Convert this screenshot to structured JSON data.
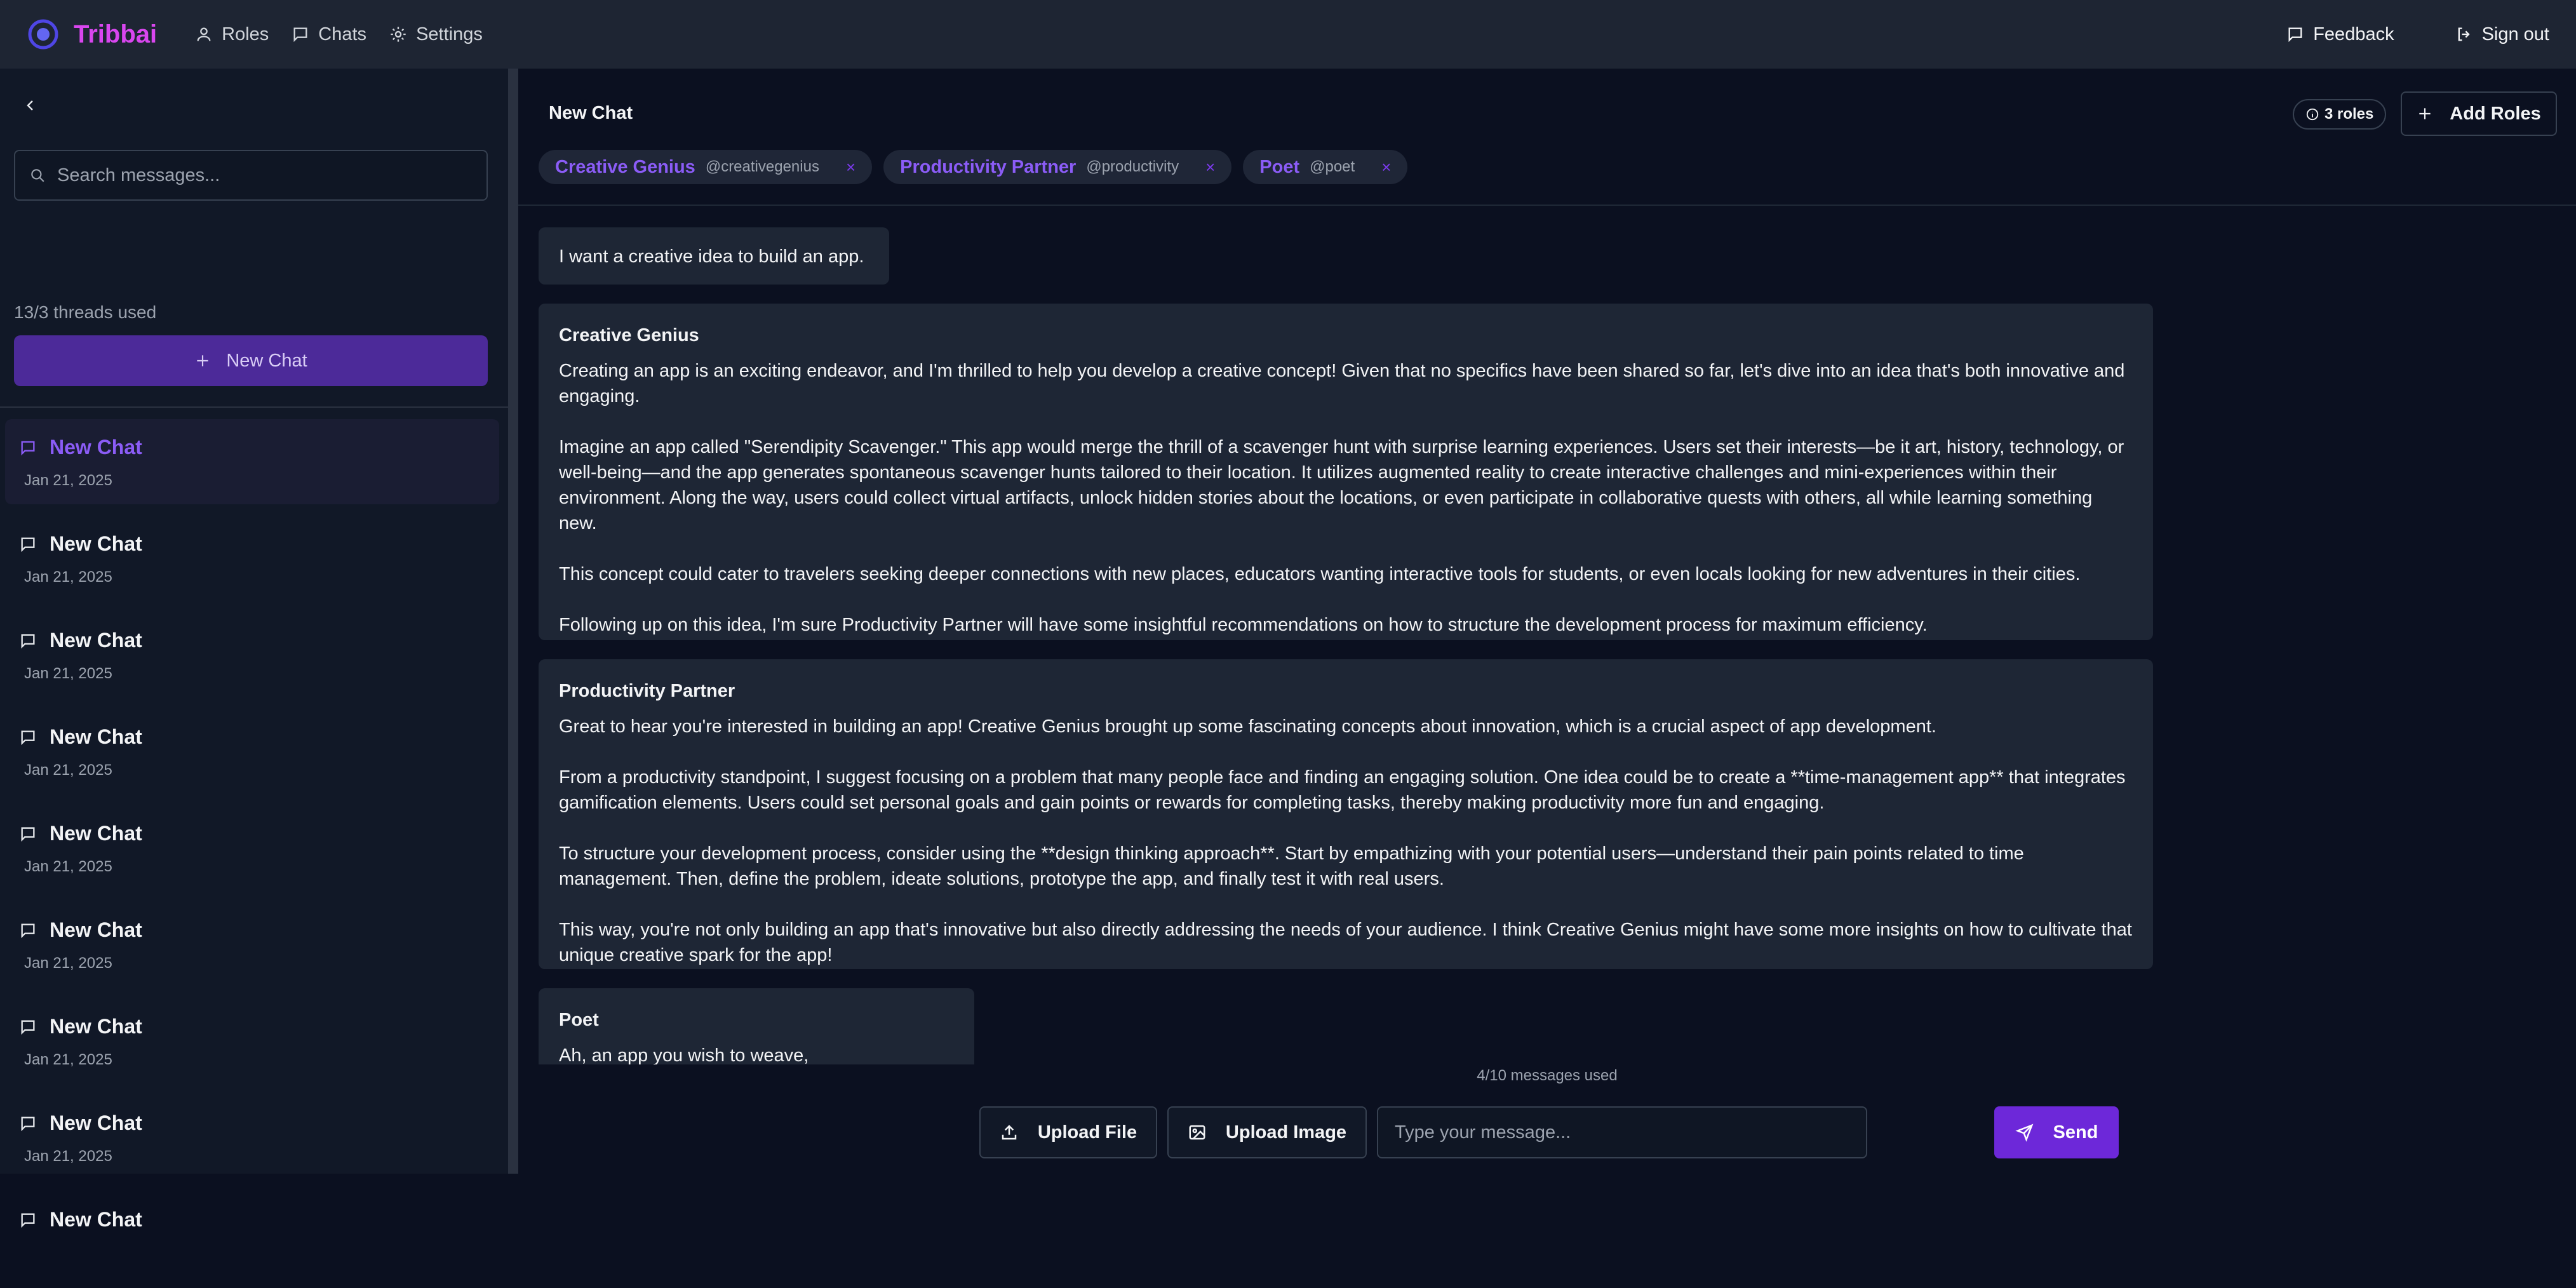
{
  "app": {
    "name": "Tribbai",
    "brand_color": "#d946ef"
  },
  "nav": {
    "items": [
      {
        "label": "Roles",
        "icon": "user-icon"
      },
      {
        "label": "Chats",
        "icon": "chat-icon"
      },
      {
        "label": "Settings",
        "icon": "gear-icon"
      }
    ],
    "feedback_label": "Feedback",
    "signout_label": "Sign out"
  },
  "sidebar": {
    "search_placeholder": "Search messages...",
    "threads_used": "13/3 threads used",
    "new_chat_label": "New Chat",
    "threads": [
      {
        "title": "New Chat",
        "date": "Jan 21, 2025",
        "active": true
      },
      {
        "title": "New Chat",
        "date": "Jan 21, 2025"
      },
      {
        "title": "New Chat",
        "date": "Jan 21, 2025"
      },
      {
        "title": "New Chat",
        "date": "Jan 21, 2025"
      },
      {
        "title": "New Chat",
        "date": "Jan 21, 2025"
      },
      {
        "title": "New Chat",
        "date": "Jan 21, 2025"
      },
      {
        "title": "New Chat",
        "date": "Jan 21, 2025"
      },
      {
        "title": "New Chat",
        "date": "Jan 21, 2025"
      },
      {
        "title": "New Chat",
        "date": ""
      }
    ]
  },
  "chat": {
    "title": "New Chat",
    "roles_count": "3 roles",
    "add_roles_label": "Add Roles",
    "roles": [
      {
        "name": "Creative Genius",
        "handle": "@creativegenius",
        "remove": "×"
      },
      {
        "name": "Productivity Partner",
        "handle": "@productivity",
        "remove": "×"
      },
      {
        "name": "Poet",
        "handle": "@poet",
        "remove": "×"
      }
    ],
    "messages": [
      {
        "sender": "",
        "paragraphs": [
          "I want a creative idea to build an app."
        ]
      },
      {
        "sender": "Creative Genius",
        "paragraphs": [
          "Creating an app is an exciting endeavor, and I'm thrilled to help you develop a creative concept! Given that no specifics have been shared so far, let's dive into an idea that's both innovative and engaging.",
          "Imagine an app called \"Serendipity Scavenger.\" This app would merge the thrill of a scavenger hunt with surprise learning experiences. Users set their interests—be it art, history, technology, or well-being—and the app generates spontaneous scavenger hunts tailored to their location. It utilizes augmented reality to create interactive challenges and mini-experiences within their environment. Along the way, users could collect virtual artifacts, unlock hidden stories about the locations, or even participate in collaborative quests with others, all while learning something new.",
          "This concept could cater to travelers seeking deeper connections with new places, educators wanting interactive tools for students, or even locals looking for new adventures in their cities.",
          "Following up on this idea, I'm sure Productivity Partner will have some insightful recommendations on how to structure the development process for maximum efficiency."
        ]
      },
      {
        "sender": "Productivity Partner",
        "paragraphs": [
          "Great to hear you're interested in building an app! Creative Genius brought up some fascinating concepts about innovation, which is a crucial aspect of app development.",
          "From a productivity standpoint, I suggest focusing on a problem that many people face and finding an engaging solution. One idea could be to create a **time-management app** that integrates gamification elements. Users could set personal goals and gain points or rewards for completing tasks, thereby making productivity more fun and engaging.",
          "To structure your development process, consider using the **design thinking approach**. Start by empathizing with your potential users—understand their pain points related to time management. Then, define the problem, ideate solutions, prototype the app, and finally test it with real users.",
          "This way, you're not only building an app that's innovative but also directly addressing the needs of your audience. I think Creative Genius might have some more insights on how to cultivate that unique creative spark for the app!"
        ]
      },
      {
        "sender": "Poet",
        "paragraphs": [
          "Ah, an app you wish to weave,"
        ]
      }
    ],
    "messages_used": "4/10 messages used",
    "upload_file_label": "Upload File",
    "upload_image_label": "Upload Image",
    "input_placeholder": "Type your message...",
    "send_label": "Send"
  },
  "colors": {
    "accent": "#8b5cf6",
    "primary_button": "#6d28d9",
    "panel": "#1e2635",
    "background": "#0b1020"
  }
}
